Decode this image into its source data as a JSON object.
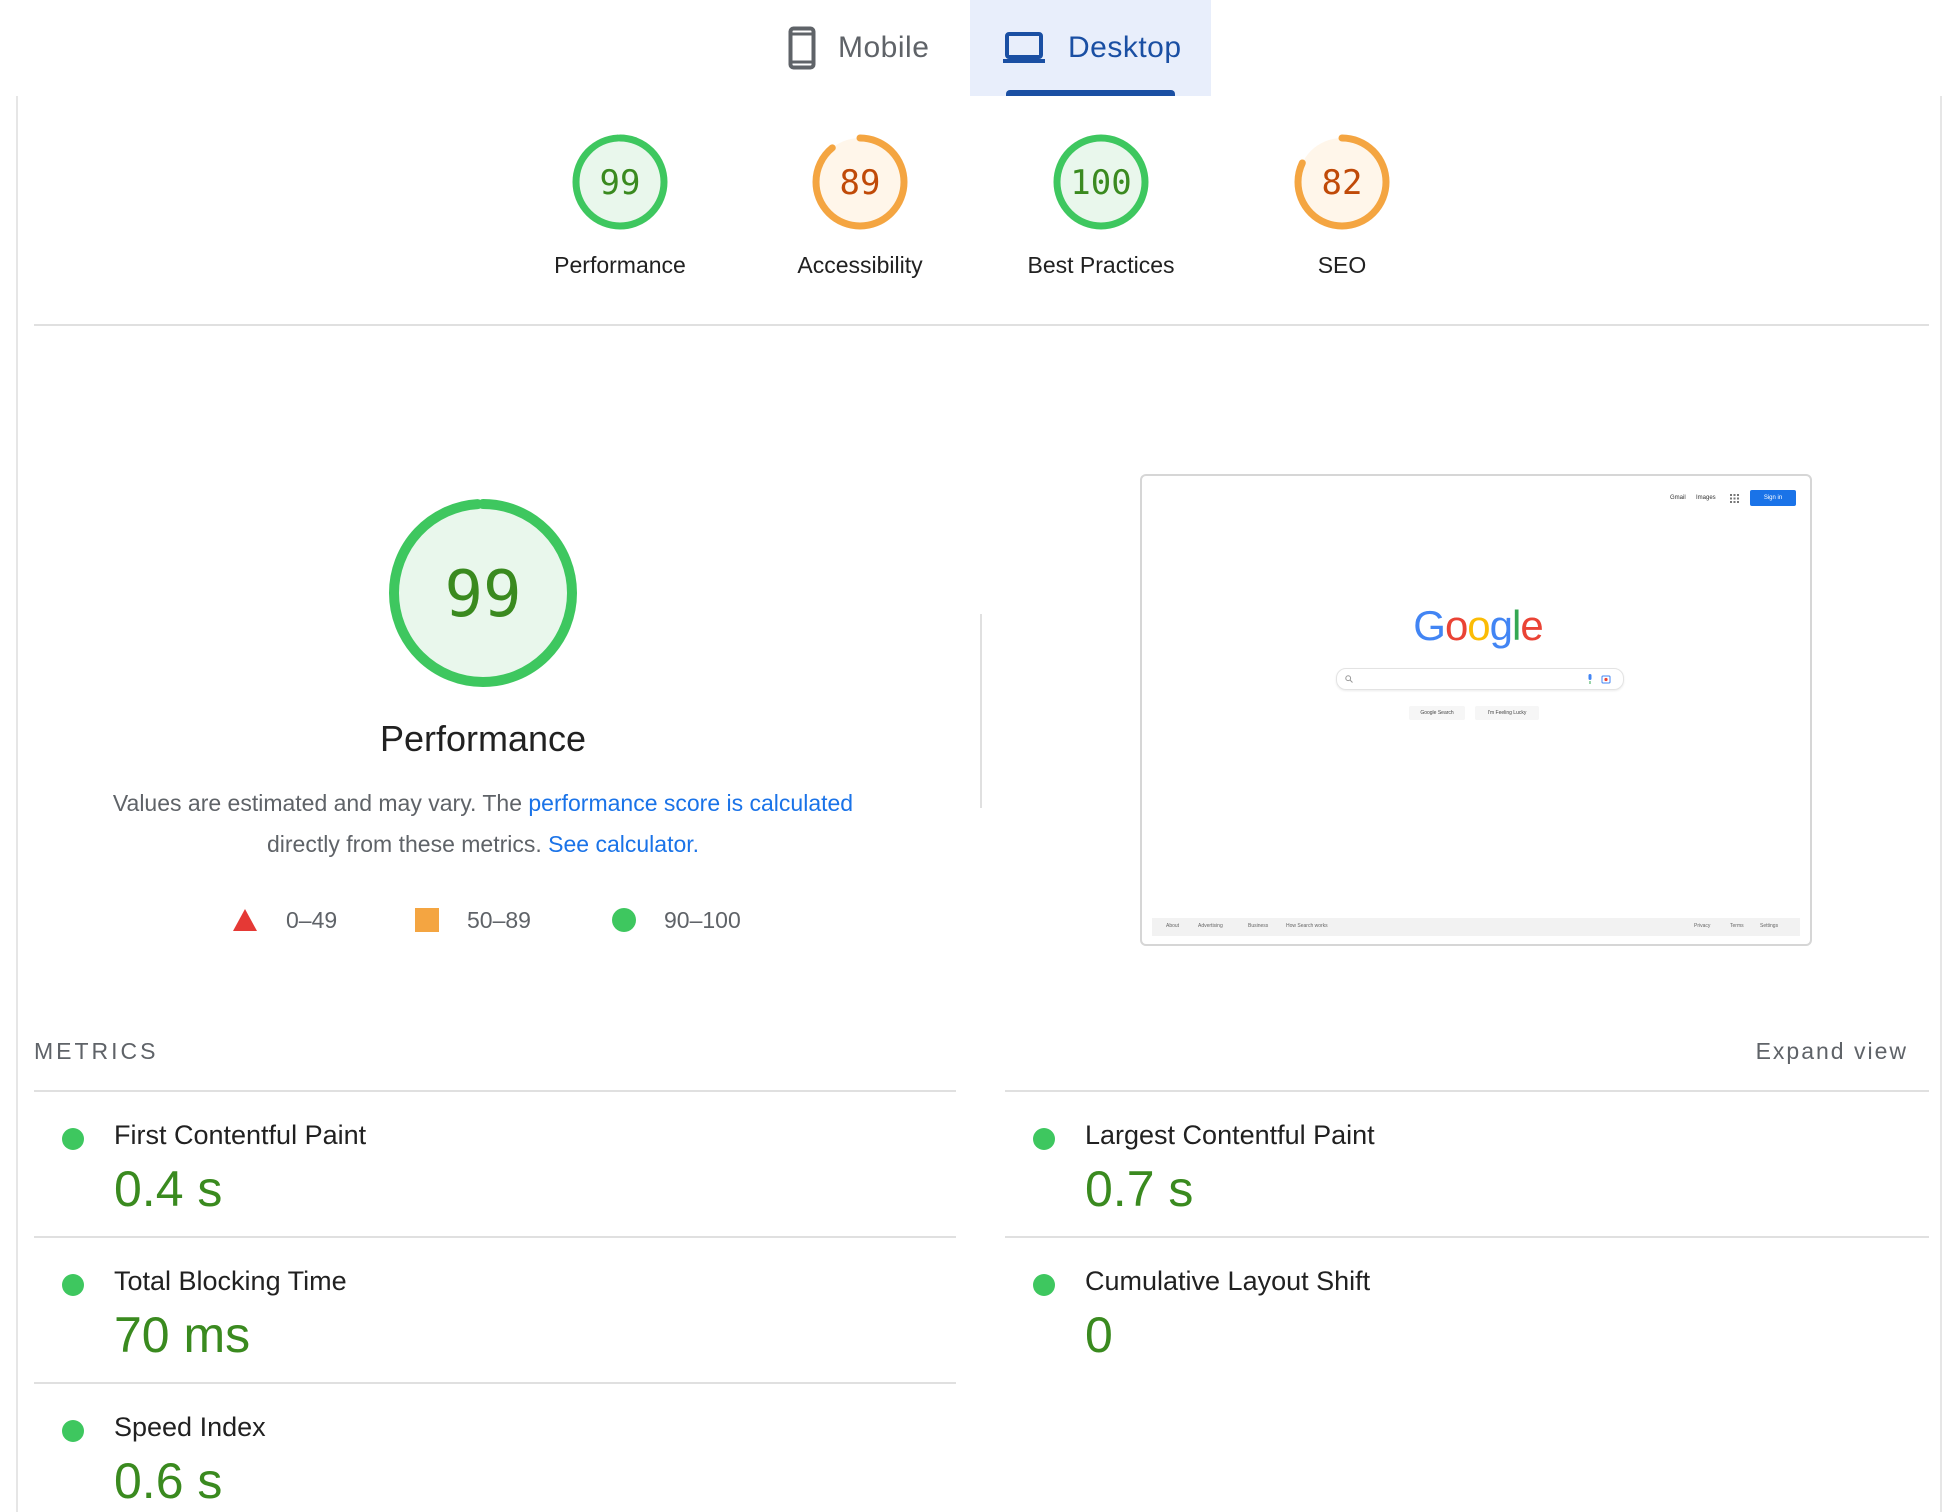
{
  "tabs": [
    {
      "label": "Mobile",
      "icon": "phone-icon",
      "selected": false
    },
    {
      "label": "Desktop",
      "icon": "laptop-icon",
      "selected": true
    }
  ],
  "scores": [
    {
      "value": "99",
      "label": "Performance",
      "status": "pass",
      "fraction": 0.99
    },
    {
      "value": "89",
      "label": "Accessibility",
      "status": "average",
      "fraction": 0.89
    },
    {
      "value": "100",
      "label": "Best Practices",
      "status": "pass",
      "fraction": 1.0
    },
    {
      "value": "82",
      "label": "SEO",
      "status": "average",
      "fraction": 0.82
    }
  ],
  "performance": {
    "score": "99",
    "fraction": 0.99,
    "title": "Performance",
    "desc_part1": "Values are estimated and may vary. The ",
    "desc_link1": "performance score is calculated",
    "desc_part2": " directly from these metrics. ",
    "desc_link2": "See calculator.",
    "legend": [
      {
        "shape": "triangle",
        "range": "0–49",
        "color": "#e53935"
      },
      {
        "shape": "square",
        "range": "50–89",
        "color": "#f4a541"
      },
      {
        "shape": "circle",
        "range": "90–100",
        "color": "#3ec75f"
      }
    ]
  },
  "screenshot": {
    "header_links": [
      "Gmail",
      "Images"
    ],
    "sign_in": "Sign in",
    "logo": "Google",
    "buttons": [
      "Google Search",
      "I'm Feeling Lucky"
    ],
    "footer_left": [
      "About",
      "Advertising",
      "Business",
      "How Search works"
    ],
    "footer_right": [
      "Privacy",
      "Terms",
      "Settings"
    ]
  },
  "metrics": {
    "heading": "METRICS",
    "expand_label": "Expand view",
    "items": [
      {
        "label": "First Contentful Paint",
        "value": "0.4 s"
      },
      {
        "label": "Largest Contentful Paint",
        "value": "0.7 s"
      },
      {
        "label": "Total Blocking Time",
        "value": "70 ms"
      },
      {
        "label": "Cumulative Layout Shift",
        "value": "0"
      },
      {
        "label": "Speed Index",
        "value": "0.6 s"
      }
    ]
  },
  "colors": {
    "pass": "#3ec75f",
    "pass_text": "#3a8a1f",
    "pass_fill": "#e9f7ec",
    "average": "#f4a541",
    "average_text": "#c04a08",
    "average_fill": "#fff6ea",
    "accent": "#1a4fa3"
  }
}
